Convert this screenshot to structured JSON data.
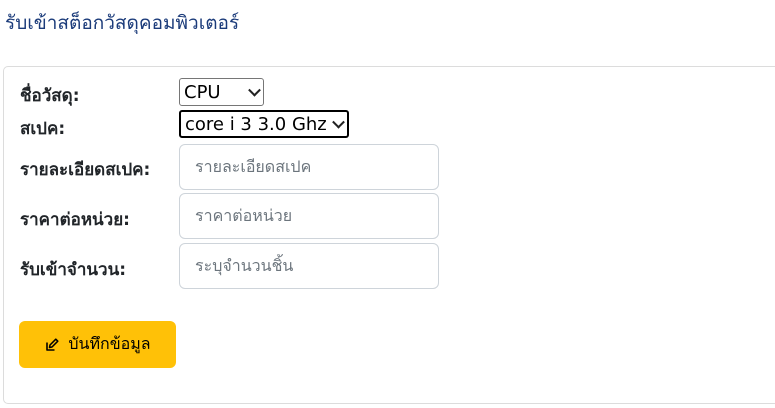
{
  "page": {
    "title": "รับเข้าสต็อกวัสดุคอมพิวเตอร์"
  },
  "form": {
    "material_name_label": "ชื่อวัสดุ:",
    "material_name_value": "CPU",
    "spec_label": "สเปค:",
    "spec_value": "core i 3 3.0 Ghz",
    "spec_detail_label": "รายละเอียดสเปค:",
    "spec_detail_placeholder": "รายละเอียดสเปค",
    "unit_price_label": "ราคาต่อหน่วย:",
    "unit_price_placeholder": "ราคาต่อหน่วย",
    "quantity_label": "รับเข้าจำนวน:",
    "quantity_placeholder": "ระบุจำนวนชิ้น"
  },
  "actions": {
    "save_label": "บันทึกข้อมูล",
    "save_icon": "edit-square-icon",
    "save_color": "#ffc107"
  }
}
